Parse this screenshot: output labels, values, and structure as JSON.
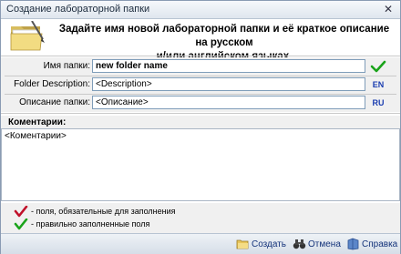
{
  "window": {
    "title": "Создание лабораторной папки",
    "close_glyph": "✕"
  },
  "header": {
    "icon": "folder-icon",
    "line1": "Задайте имя новой лабораторной папки и её краткое описание на русском",
    "line2": "и/или  английском языках."
  },
  "form": {
    "name": {
      "label": "Имя папки:",
      "value": "new folder name",
      "mark_icon": "green-check-icon"
    },
    "description_en": {
      "label": "Folder Description:",
      "value": "<Description>",
      "lang": "EN"
    },
    "description_ru": {
      "label": "Описание папки:",
      "value": "<Описание>",
      "lang": "RU"
    }
  },
  "comment": {
    "label": "Коментарии:",
    "value": "<Коментарии>"
  },
  "legend": {
    "required": "- поля, обязательные для заполнения",
    "valid": "- правильно заполненные поля"
  },
  "footer": {
    "create": {
      "label": "Создать",
      "icon": "folder-icon"
    },
    "cancel": {
      "label": "Отмена",
      "icon": "binoculars-icon"
    },
    "help": {
      "label": "Справка",
      "icon": "help-icon"
    }
  },
  "colors": {
    "required_mark": "#c0102a",
    "valid_mark": "#1aa31a",
    "lang_tag": "#1a3db0"
  }
}
